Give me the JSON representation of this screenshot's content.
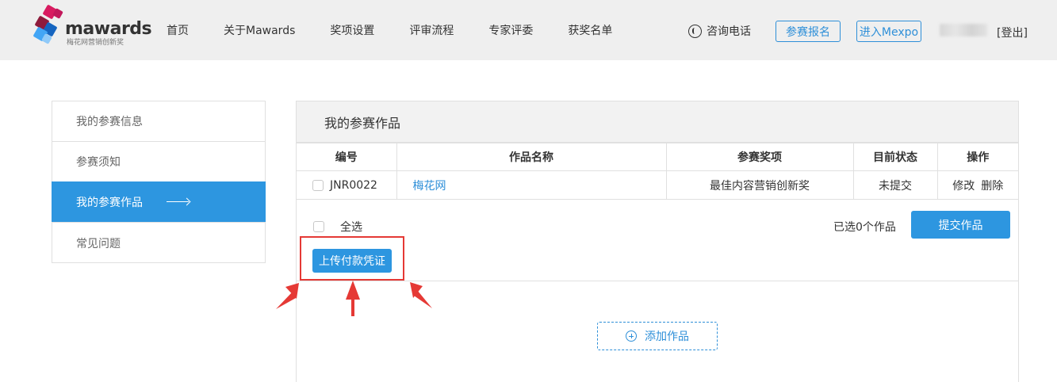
{
  "header": {
    "logo_word": "mawards",
    "logo_sub": "梅花网营销创新奖",
    "nav": [
      "首页",
      "关于Mawards",
      "奖项设置",
      "评审流程",
      "专家评委",
      "获奖名单"
    ],
    "hotline_label": "咨询电话",
    "register_label": "参赛报名",
    "mexpo_label": "进入Mexpo",
    "logout_label": "[登出]"
  },
  "sidebar": {
    "items": [
      {
        "label": "我的参赛信息",
        "active": false
      },
      {
        "label": "参赛须知",
        "active": false
      },
      {
        "label": "我的参赛作品",
        "active": true
      },
      {
        "label": "常见问题",
        "active": false
      }
    ]
  },
  "main": {
    "title": "我的参赛作品",
    "columns": [
      "编号",
      "作品名称",
      "参赛奖项",
      "目前状态",
      "操作"
    ],
    "rows": [
      {
        "code": "JNR0022",
        "name": "梅花网",
        "award": "最佳内容营销创新奖",
        "status": "未提交",
        "edit_label": "修改",
        "delete_label": "删除"
      }
    ],
    "select_all_label": "全选",
    "selected_count": "已选0个作品",
    "submit_label": "提交作品",
    "upload_label": "上传付款凭证",
    "add_label": "添加作品"
  },
  "colors": {
    "accent": "#2d96e0",
    "link": "#2e8fd8",
    "annotation": "#e53935"
  }
}
